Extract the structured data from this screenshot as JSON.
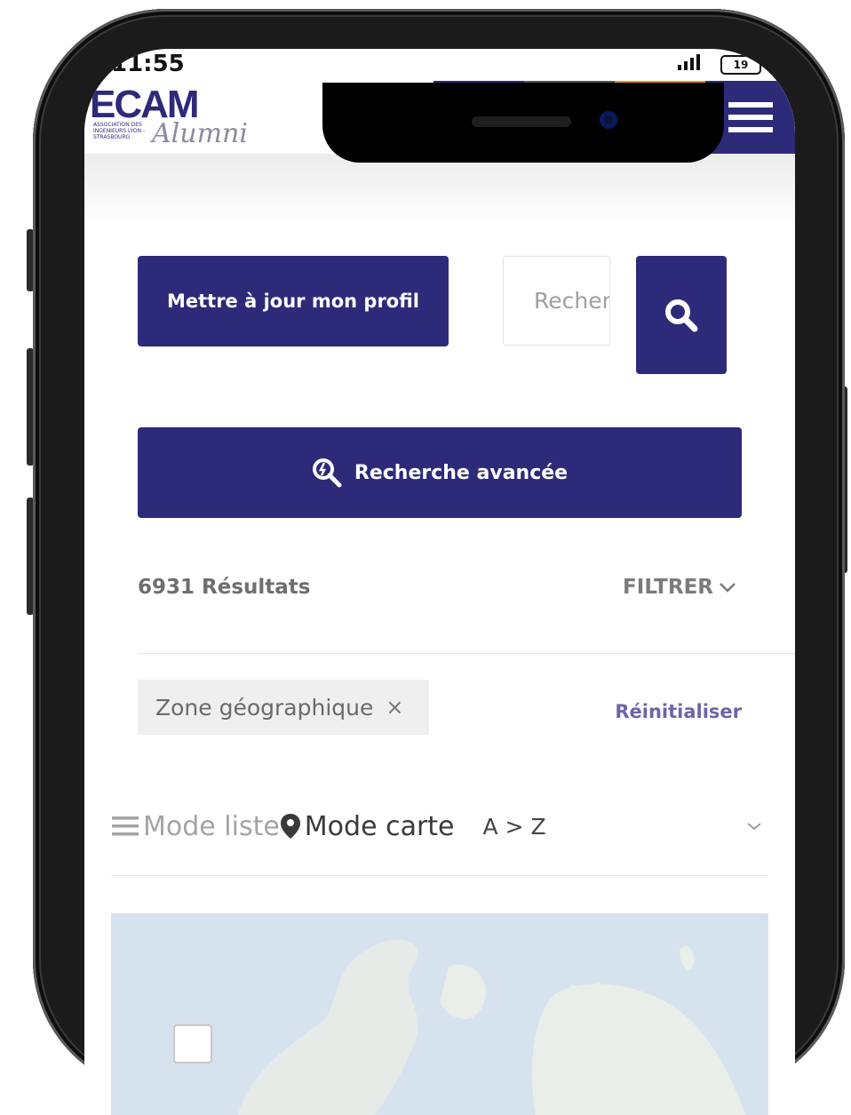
{
  "status_bar": {
    "time": "11:55",
    "battery": "19"
  },
  "header": {
    "logo_text": "ECAM",
    "logo_subtitle": "ASSOCIATION DES INGENIEURS LYON - STRASBOURG",
    "logo_script": "Alumni",
    "colors": {
      "primary": "#2e2a7a",
      "chat": "#555555",
      "user": "#f39200"
    }
  },
  "actions": {
    "update_profile_label": "Mettre à jour mon profil",
    "search_placeholder": "Recherche",
    "advanced_search_label": "Recherche avancée"
  },
  "results": {
    "count_label": "6931 Résultats",
    "filter_label": "FILTRER"
  },
  "filters": {
    "chip_label": "Zone géographique",
    "chip_remove": "×",
    "reset_label": "Réinitialiser"
  },
  "view": {
    "list_mode_label": "Mode liste",
    "map_mode_label": "Mode carte",
    "sort_value": "A > Z"
  }
}
